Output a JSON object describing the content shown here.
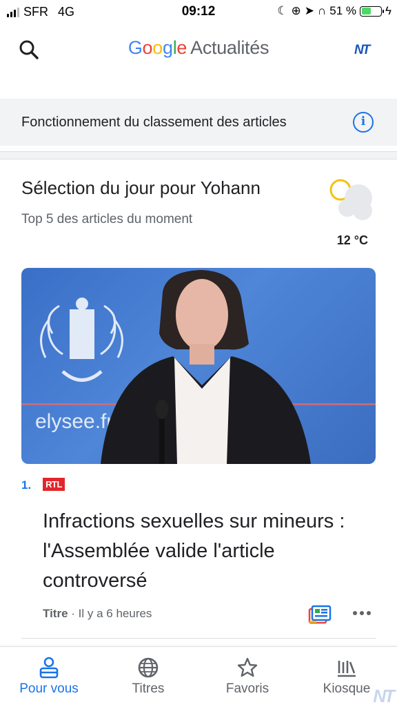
{
  "status_bar": {
    "carrier": "SFR",
    "network": "4G",
    "time": "09:12",
    "battery_percent_label": "51 %",
    "battery_level": 0.51
  },
  "header": {
    "logo_parts": [
      "G",
      "o",
      "o",
      "g",
      "l",
      "e"
    ],
    "product": "Actualités",
    "avatar_initials": "NT"
  },
  "banner": {
    "text": "Fonctionnement du classement des articles",
    "info_glyph": "i"
  },
  "section": {
    "title": "Sélection du jour pour Yohann",
    "subtitle": "Top 5 des articles du moment",
    "temperature": "12 °C"
  },
  "article": {
    "rank": "1.",
    "source": "RTL",
    "headline": "Infractions sexuelles sur mineurs : l'Assemblée valide l'article controversé",
    "kind": "Titre",
    "time": " · Il y a 6 heures",
    "image_text": "elysee.fr"
  },
  "bottom_nav": {
    "items": [
      {
        "label": "Pour vous",
        "icon": "person-icon"
      },
      {
        "label": "Titres",
        "icon": "globe-icon"
      },
      {
        "label": "Favoris",
        "icon": "star-icon"
      },
      {
        "label": "Kiosque",
        "icon": "kiosk-icon"
      }
    ],
    "active": "Pour vous"
  },
  "watermark": "NT",
  "colors": {
    "accent": "#1a73e8",
    "banner_bg": "#f1f3f4",
    "rtl_red": "#e3262c"
  }
}
